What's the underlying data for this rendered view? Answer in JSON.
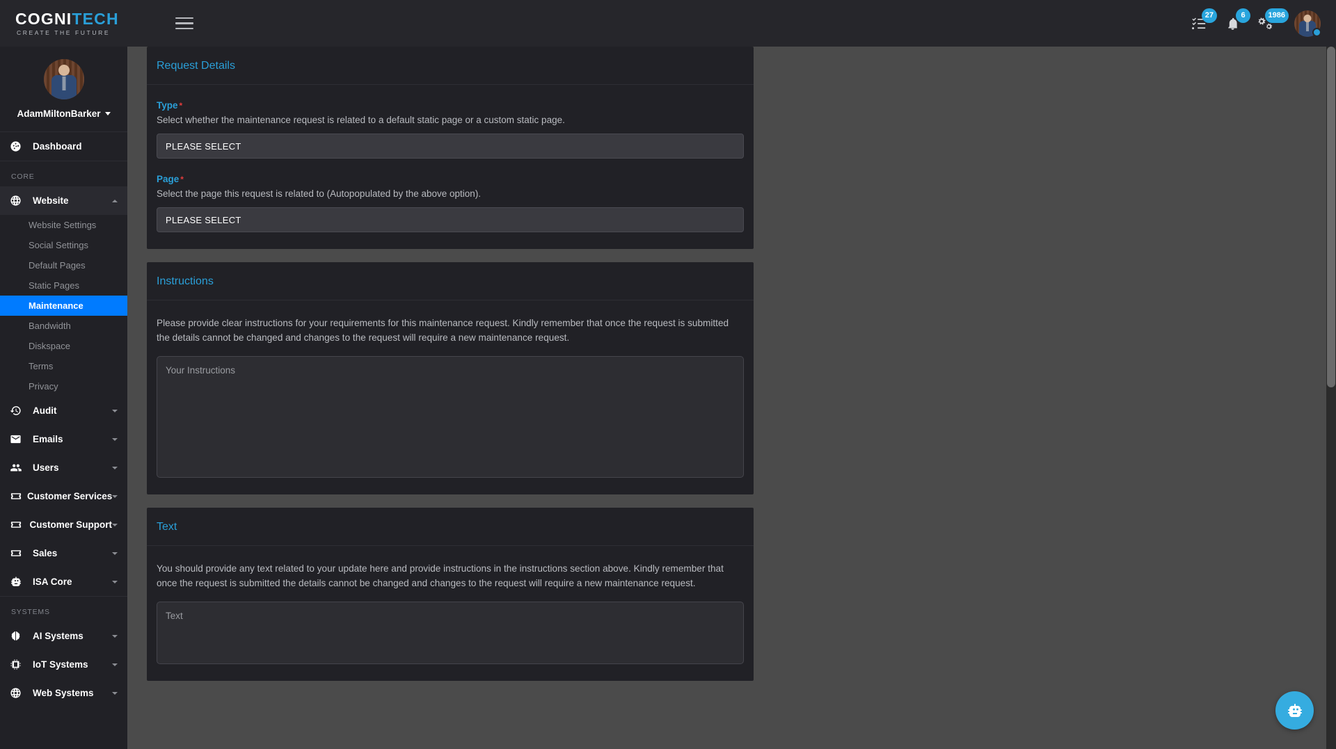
{
  "brand": {
    "name_part1": "COGNI",
    "name_part2": "TECH",
    "tagline": "CREATE THE FUTURE",
    "accent_color": "#2a9fd8"
  },
  "topbar": {
    "menu_toggle": "menu-toggle",
    "tasks_badge": "27",
    "notifications_badge": "6",
    "settings_badge": "1986"
  },
  "sidebar": {
    "user": {
      "name": "AdamMiltonBarker"
    },
    "dashboard": {
      "label": "Dashboard"
    },
    "sections": [
      {
        "title": "CORE",
        "groups": [
          {
            "label": "Website",
            "icon": "globe-icon",
            "expanded": true,
            "children": [
              {
                "label": "Website Settings",
                "active": false
              },
              {
                "label": "Social Settings",
                "active": false
              },
              {
                "label": "Default Pages",
                "active": false
              },
              {
                "label": "Static Pages",
                "active": false
              },
              {
                "label": "Maintenance",
                "active": true
              },
              {
                "label": "Bandwidth",
                "active": false
              },
              {
                "label": "Diskspace",
                "active": false
              },
              {
                "label": "Terms",
                "active": false
              },
              {
                "label": "Privacy",
                "active": false
              }
            ]
          },
          {
            "label": "Audit",
            "icon": "history-icon",
            "expanded": false,
            "children": []
          },
          {
            "label": "Emails",
            "icon": "envelope-icon",
            "expanded": false,
            "children": []
          },
          {
            "label": "Users",
            "icon": "users-icon",
            "expanded": false,
            "children": []
          },
          {
            "label": "Customer Services",
            "icon": "ticket-icon",
            "expanded": false,
            "children": []
          },
          {
            "label": "Customer Support",
            "icon": "ticket-icon",
            "expanded": false,
            "children": []
          },
          {
            "label": "Sales",
            "icon": "ticket-icon",
            "expanded": false,
            "children": []
          },
          {
            "label": "ISA Core",
            "icon": "robot-icon",
            "expanded": false,
            "children": []
          }
        ]
      },
      {
        "title": "SYSTEMS",
        "groups": [
          {
            "label": "AI Systems",
            "icon": "brain-icon",
            "expanded": false,
            "children": []
          },
          {
            "label": "IoT Systems",
            "icon": "microchip-icon",
            "expanded": false,
            "children": []
          },
          {
            "label": "Web Systems",
            "icon": "globe-icon",
            "expanded": false,
            "children": []
          }
        ]
      }
    ]
  },
  "main": {
    "cards": [
      {
        "title": "Request Details",
        "fields": [
          {
            "label": "Type",
            "required": "*",
            "help": "Select whether the maintenance request is related to a default static page or a custom static page.",
            "value": "PLEASE SELECT"
          },
          {
            "label": "Page",
            "required": "*",
            "help": "Select the page this request is related to (Autopopulated by the above option).",
            "value": "PLEASE SELECT"
          }
        ]
      },
      {
        "title": "Instructions",
        "body": "Please provide clear instructions for your requirements for this maintenance request. Kindly remember that once the request is submitted the details cannot be changed and changes to the request will require a new maintenance request.",
        "textarea_placeholder": "Your Instructions"
      },
      {
        "title": "Text",
        "body": "You should provide any text related to your update here and provide instructions in the instructions section above. Kindly remember that once the request is submitted the details cannot be changed and changes to the request will require a new maintenance request.",
        "textarea_placeholder": "Text"
      }
    ]
  },
  "fab": {
    "icon": "robot-icon",
    "color": "#35ace0"
  }
}
